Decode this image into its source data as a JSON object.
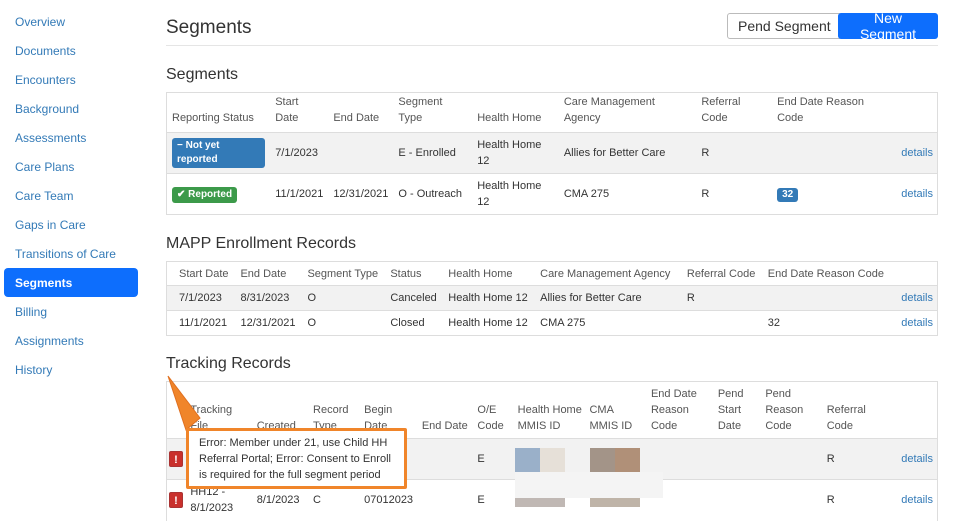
{
  "sidebar": {
    "items": [
      {
        "label": "Overview"
      },
      {
        "label": "Documents"
      },
      {
        "label": "Encounters"
      },
      {
        "label": "Background"
      },
      {
        "label": "Assessments"
      },
      {
        "label": "Care Plans"
      },
      {
        "label": "Care Team"
      },
      {
        "label": "Gaps in Care"
      },
      {
        "label": "Transitions of Care"
      },
      {
        "label": "Segments"
      },
      {
        "label": "Billing"
      },
      {
        "label": "Assignments"
      },
      {
        "label": "History"
      }
    ]
  },
  "page": {
    "title": "Segments",
    "pend_label": "Pend Segment",
    "new_label": "New Segment"
  },
  "segments": {
    "title": "Segments",
    "headers": [
      "Reporting Status",
      "Start Date",
      "End Date",
      "Segment Type",
      "Health Home",
      "Care Management Agency",
      "Referral Code",
      "End Date Reason Code"
    ],
    "rows": [
      {
        "status": "− Not yet reported",
        "start": "7/1/2023",
        "end": "",
        "type": "E - Enrolled",
        "hh": "Health Home 12",
        "cma": "Allies for Better Care",
        "ref": "R",
        "reason": "",
        "details": "details"
      },
      {
        "status": "✔ Reported",
        "start": "11/1/2021",
        "end": "12/31/2021",
        "type": "O - Outreach",
        "hh": "Health Home 12",
        "cma": "CMA 275",
        "ref": "R",
        "reason": "32",
        "details": "details"
      }
    ]
  },
  "mapp": {
    "title": "MAPP Enrollment Records",
    "headers": [
      "Start Date",
      "End Date",
      "Segment Type",
      "Status",
      "Health Home",
      "Care Management Agency",
      "Referral Code",
      "End Date Reason Code"
    ],
    "rows": [
      {
        "start": "7/1/2023",
        "end": "8/31/2023",
        "type": "O",
        "status": "Canceled",
        "hh": "Health Home 12",
        "cma": "Allies for Better Care",
        "ref": "R",
        "reason": "",
        "details": "details"
      },
      {
        "start": "11/1/2021",
        "end": "12/31/2021",
        "type": "O",
        "status": "Closed",
        "hh": "Health Home 12",
        "cma": "CMA 275",
        "ref": "",
        "reason": "32",
        "details": "details"
      }
    ]
  },
  "tracking": {
    "title": "Tracking Records",
    "headers": [
      "Tracking File",
      "Created",
      "Record Type",
      "Begin Date",
      "End Date",
      "O/E Code",
      "Health Home MMIS ID",
      "CMA MMIS ID",
      "End Date Reason Code",
      "Pend Start Date",
      "Pend Reason Code",
      "Referral Code"
    ],
    "rows": [
      {
        "file": "",
        "created": "",
        "rtype": "",
        "begin": "23",
        "end": "",
        "oe": "E",
        "ref": "R",
        "details": "details"
      },
      {
        "file": "HH12 - 8/1/2023",
        "created": "8/1/2023",
        "rtype": "C",
        "begin": "07012023",
        "end": "",
        "oe": "E",
        "ref": "R",
        "details": "details"
      }
    ]
  },
  "tooltip": {
    "text": "Error: Member under 21, use Child HH Referral Portal; Error: Consent to Enroll is required for the full segment period"
  },
  "colors": {
    "accent": "#0d6efd",
    "link": "#337ab7",
    "success": "#3c9a4a",
    "error": "#c9302c",
    "highlight": "#f0852a"
  }
}
